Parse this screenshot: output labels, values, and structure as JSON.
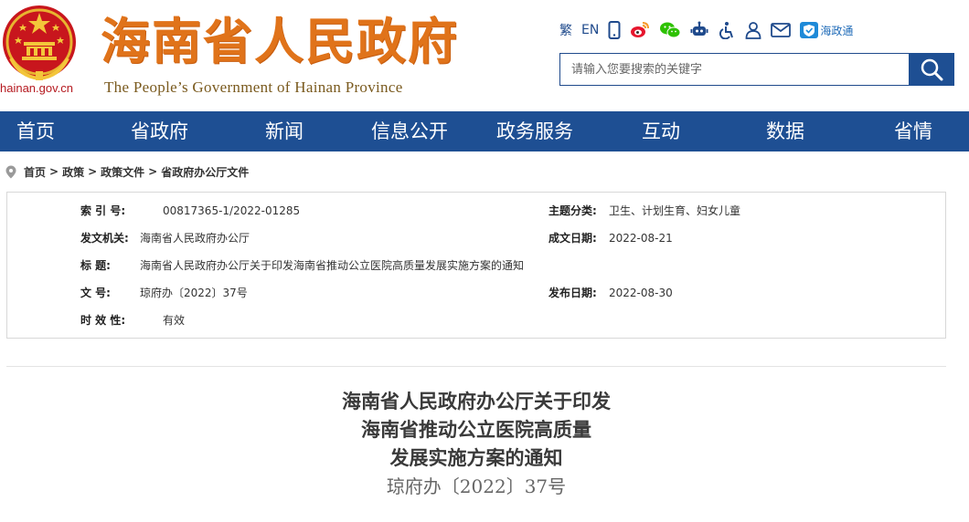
{
  "header": {
    "domain": "hainan.gov.cn",
    "title": "海南省人民政府",
    "subtitle": "The People’s Government  of Hainan Province"
  },
  "toolbar": {
    "traditional": "繁",
    "english": "EN",
    "icons": [
      "mobile-icon",
      "weibo-icon",
      "wechat-icon",
      "robot-icon",
      "accessibility-icon",
      "user-icon",
      "mail-icon"
    ],
    "hzt_label": "海政通"
  },
  "search": {
    "placeholder": "请输入您要搜索的关键字"
  },
  "nav": {
    "items": [
      "首页",
      "省政府",
      "新闻",
      "信息公开",
      "政务服务",
      "互动",
      "数据",
      "省情"
    ]
  },
  "breadcrumb": {
    "items": [
      "首页",
      "政策",
      "政策文件",
      "省政府办公厅文件"
    ],
    "separator": ">"
  },
  "info": {
    "index_label": "索 引 号:",
    "index_value": "00817365-1/2022-01285",
    "topic_label": "主题分类:",
    "topic_value": "卫生、计划生育、妇女儿童",
    "issuer_label": "发文机关:",
    "issuer_value": "海南省人民政府办公厅",
    "created_label": "成文日期:",
    "created_value": "2022-08-21",
    "title_label": "标 题:",
    "title_value": "海南省人民政府办公厅关于印发海南省推动公立医院高质量发展实施方案的通知",
    "docno_label": "文 号:",
    "docno_value": "琼府办〔2022〕37号",
    "published_label": "发布日期:",
    "published_value": "2022-08-30",
    "validity_label": "时 效 性:",
    "validity_value": "有效"
  },
  "article": {
    "title_lines": [
      "海南省人民政府办公厅关于印发",
      "海南省推动公立医院高质量",
      "发展实施方案的通知"
    ],
    "doc_number": "琼府办〔2022〕37号"
  },
  "colors": {
    "nav_bg": "#1e4f93",
    "title_orange": "#e0731a",
    "emblem_red": "#c8161d"
  }
}
